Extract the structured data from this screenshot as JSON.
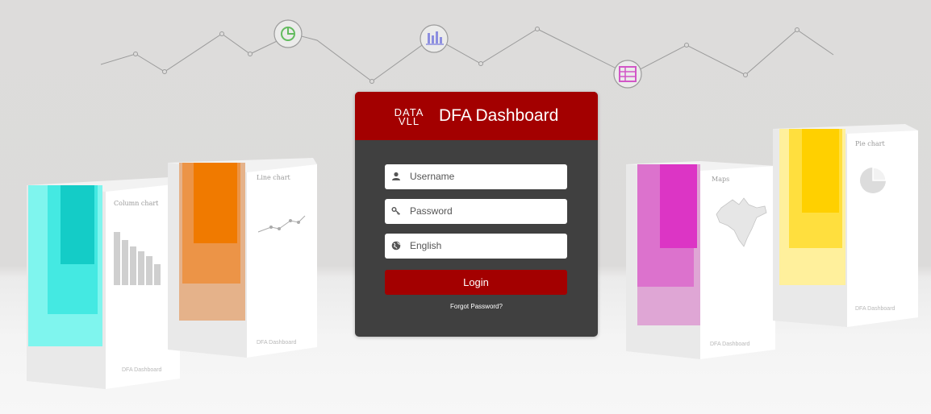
{
  "login": {
    "logo_text_top": "DATA",
    "logo_text_bottom": "VLL",
    "app_title": "DFA Dashboard",
    "username_placeholder": "Username",
    "password_placeholder": "Password",
    "language_selected": "English",
    "login_button": "Login",
    "forgot_password": "Forgot Password?"
  },
  "boxes": [
    {
      "label": "Column chart",
      "brand": "DFA Dashboard",
      "color": "#3ee6dc"
    },
    {
      "label": "Line chart",
      "brand": "DFA Dashboard",
      "color": "#ee8a2a"
    },
    {
      "label": "Maps",
      "brand": "DFA Dashboard",
      "color": "#dd5cd0"
    },
    {
      "label": "Pie chart",
      "brand": "DFA Dashboard",
      "color": "#ffd600"
    }
  ],
  "icons": [
    "pie-chart-icon",
    "bar-chart-icon",
    "list-icon"
  ],
  "colors": {
    "brand_red": "#a30000",
    "panel_bg": "#404040"
  }
}
